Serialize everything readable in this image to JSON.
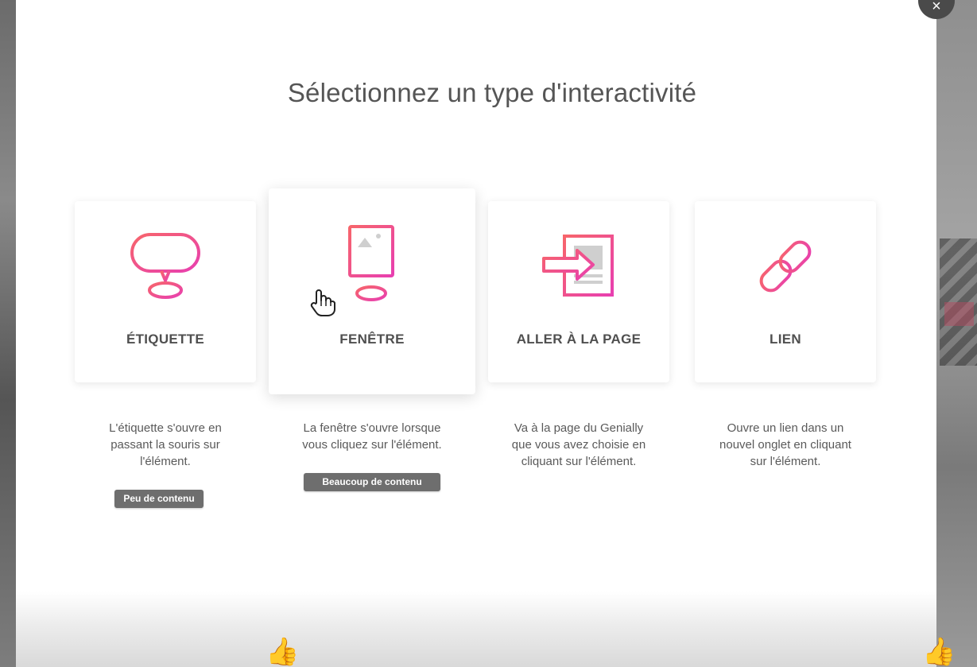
{
  "modal": {
    "title": "Sélectionnez un type d'interactivité",
    "close_icon": "×"
  },
  "options": [
    {
      "label": "ÉTIQUETTE",
      "icon": "speech-bubble-icon",
      "description": [
        "L'étiquette s'ouvre en",
        "passant la souris sur",
        "l'élément."
      ],
      "badge": "Peu de contenu"
    },
    {
      "label": "FENÊTRE",
      "icon": "window-popup-icon",
      "description": [
        "La fenêtre s'ouvre lorsque",
        "vous cliquez sur l'élément."
      ],
      "badge": "Beaucoup de contenu"
    },
    {
      "label": "ALLER À LA PAGE",
      "icon": "go-to-page-icon",
      "description": [
        "Va à la page du Genially",
        "que vous avez choisie en",
        "cliquant sur l'élément."
      ]
    },
    {
      "label": "LIEN",
      "icon": "link-icon",
      "description": [
        "Ouvre un lien dans un",
        "nouvel onglet en cliquant",
        "sur l'élément."
      ]
    }
  ],
  "colors": {
    "accent_pink": "#ee4fa6",
    "accent_orange": "#f7656b",
    "text_dark": "#555555",
    "badge_bg": "#6e6e6e"
  },
  "reactions": {
    "thumb_icon": "👍"
  }
}
